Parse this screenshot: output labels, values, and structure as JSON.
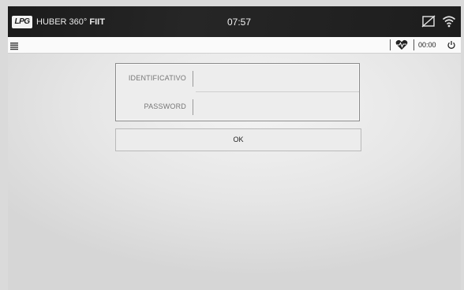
{
  "statusbar": {
    "logo": "LPG",
    "brand_text": "HUBER 360°",
    "brand_bold": "FIIT",
    "time": "07:57",
    "icons": [
      "no-signal-icon",
      "wifi-icon"
    ]
  },
  "toolbar": {
    "menu_icon": "menu-icon",
    "heart_icon": "heart-rate-icon",
    "timer": "00:00",
    "power_icon": "power-icon"
  },
  "login": {
    "id_label": "IDENTIFICATIVO",
    "id_value": "",
    "password_label": "PASSWORD",
    "password_value": "",
    "ok_label": "OK"
  },
  "colors": {
    "topbar": "#1d1d1d",
    "toolbar": "#fafafa",
    "background": "#e6e6e6"
  }
}
